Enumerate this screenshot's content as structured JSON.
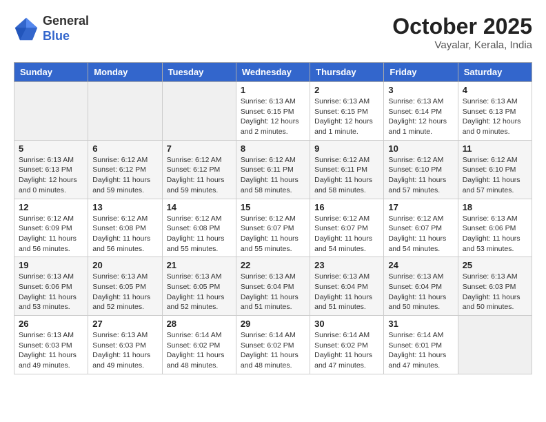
{
  "header": {
    "logo_general": "General",
    "logo_blue": "Blue",
    "month_year": "October 2025",
    "location": "Vayalar, Kerala, India"
  },
  "weekdays": [
    "Sunday",
    "Monday",
    "Tuesday",
    "Wednesday",
    "Thursday",
    "Friday",
    "Saturday"
  ],
  "weeks": [
    [
      {
        "day": "",
        "info": ""
      },
      {
        "day": "",
        "info": ""
      },
      {
        "day": "",
        "info": ""
      },
      {
        "day": "1",
        "info": "Sunrise: 6:13 AM\nSunset: 6:15 PM\nDaylight: 12 hours\nand 2 minutes."
      },
      {
        "day": "2",
        "info": "Sunrise: 6:13 AM\nSunset: 6:15 PM\nDaylight: 12 hours\nand 1 minute."
      },
      {
        "day": "3",
        "info": "Sunrise: 6:13 AM\nSunset: 6:14 PM\nDaylight: 12 hours\nand 1 minute."
      },
      {
        "day": "4",
        "info": "Sunrise: 6:13 AM\nSunset: 6:13 PM\nDaylight: 12 hours\nand 0 minutes."
      }
    ],
    [
      {
        "day": "5",
        "info": "Sunrise: 6:13 AM\nSunset: 6:13 PM\nDaylight: 12 hours\nand 0 minutes."
      },
      {
        "day": "6",
        "info": "Sunrise: 6:12 AM\nSunset: 6:12 PM\nDaylight: 11 hours\nand 59 minutes."
      },
      {
        "day": "7",
        "info": "Sunrise: 6:12 AM\nSunset: 6:12 PM\nDaylight: 11 hours\nand 59 minutes."
      },
      {
        "day": "8",
        "info": "Sunrise: 6:12 AM\nSunset: 6:11 PM\nDaylight: 11 hours\nand 58 minutes."
      },
      {
        "day": "9",
        "info": "Sunrise: 6:12 AM\nSunset: 6:11 PM\nDaylight: 11 hours\nand 58 minutes."
      },
      {
        "day": "10",
        "info": "Sunrise: 6:12 AM\nSunset: 6:10 PM\nDaylight: 11 hours\nand 57 minutes."
      },
      {
        "day": "11",
        "info": "Sunrise: 6:12 AM\nSunset: 6:10 PM\nDaylight: 11 hours\nand 57 minutes."
      }
    ],
    [
      {
        "day": "12",
        "info": "Sunrise: 6:12 AM\nSunset: 6:09 PM\nDaylight: 11 hours\nand 56 minutes."
      },
      {
        "day": "13",
        "info": "Sunrise: 6:12 AM\nSunset: 6:08 PM\nDaylight: 11 hours\nand 56 minutes."
      },
      {
        "day": "14",
        "info": "Sunrise: 6:12 AM\nSunset: 6:08 PM\nDaylight: 11 hours\nand 55 minutes."
      },
      {
        "day": "15",
        "info": "Sunrise: 6:12 AM\nSunset: 6:07 PM\nDaylight: 11 hours\nand 55 minutes."
      },
      {
        "day": "16",
        "info": "Sunrise: 6:12 AM\nSunset: 6:07 PM\nDaylight: 11 hours\nand 54 minutes."
      },
      {
        "day": "17",
        "info": "Sunrise: 6:12 AM\nSunset: 6:07 PM\nDaylight: 11 hours\nand 54 minutes."
      },
      {
        "day": "18",
        "info": "Sunrise: 6:13 AM\nSunset: 6:06 PM\nDaylight: 11 hours\nand 53 minutes."
      }
    ],
    [
      {
        "day": "19",
        "info": "Sunrise: 6:13 AM\nSunset: 6:06 PM\nDaylight: 11 hours\nand 53 minutes."
      },
      {
        "day": "20",
        "info": "Sunrise: 6:13 AM\nSunset: 6:05 PM\nDaylight: 11 hours\nand 52 minutes."
      },
      {
        "day": "21",
        "info": "Sunrise: 6:13 AM\nSunset: 6:05 PM\nDaylight: 11 hours\nand 52 minutes."
      },
      {
        "day": "22",
        "info": "Sunrise: 6:13 AM\nSunset: 6:04 PM\nDaylight: 11 hours\nand 51 minutes."
      },
      {
        "day": "23",
        "info": "Sunrise: 6:13 AM\nSunset: 6:04 PM\nDaylight: 11 hours\nand 51 minutes."
      },
      {
        "day": "24",
        "info": "Sunrise: 6:13 AM\nSunset: 6:04 PM\nDaylight: 11 hours\nand 50 minutes."
      },
      {
        "day": "25",
        "info": "Sunrise: 6:13 AM\nSunset: 6:03 PM\nDaylight: 11 hours\nand 50 minutes."
      }
    ],
    [
      {
        "day": "26",
        "info": "Sunrise: 6:13 AM\nSunset: 6:03 PM\nDaylight: 11 hours\nand 49 minutes."
      },
      {
        "day": "27",
        "info": "Sunrise: 6:13 AM\nSunset: 6:03 PM\nDaylight: 11 hours\nand 49 minutes."
      },
      {
        "day": "28",
        "info": "Sunrise: 6:14 AM\nSunset: 6:02 PM\nDaylight: 11 hours\nand 48 minutes."
      },
      {
        "day": "29",
        "info": "Sunrise: 6:14 AM\nSunset: 6:02 PM\nDaylight: 11 hours\nand 48 minutes."
      },
      {
        "day": "30",
        "info": "Sunrise: 6:14 AM\nSunset: 6:02 PM\nDaylight: 11 hours\nand 47 minutes."
      },
      {
        "day": "31",
        "info": "Sunrise: 6:14 AM\nSunset: 6:01 PM\nDaylight: 11 hours\nand 47 minutes."
      },
      {
        "day": "",
        "info": ""
      }
    ]
  ]
}
